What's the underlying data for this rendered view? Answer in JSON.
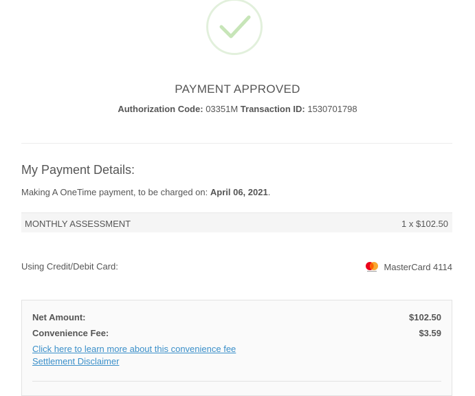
{
  "status": {
    "title": "PAYMENT APPROVED",
    "auth_label": "Authorization Code:",
    "auth_code": "03351M",
    "txn_label": "Transaction ID:",
    "txn_id": "1530701798",
    "icon": "checkmark-icon",
    "accent_color": "#c7e5b8"
  },
  "details": {
    "heading": "My Payment Details:",
    "making_prefix": "Making A OneTime payment, to be charged on:",
    "charge_date": "April 06, 2021",
    "making_suffix": "."
  },
  "line_item": {
    "name": "MONTHLY ASSESSMENT",
    "price": "1 x $102.50"
  },
  "card": {
    "label": "Using Credit/Debit Card:",
    "brand_icon": "mastercard-icon",
    "name": "MasterCard 4114"
  },
  "summary": {
    "net_label": "Net Amount:",
    "net_value": "$102.50",
    "fee_label": "Convenience Fee:",
    "fee_value": "$3.59",
    "fee_link": "Click here to learn more about this convenience fee",
    "disclaimer_link": "Settlement Disclaimer",
    "link_color": "#3a8fc9"
  }
}
